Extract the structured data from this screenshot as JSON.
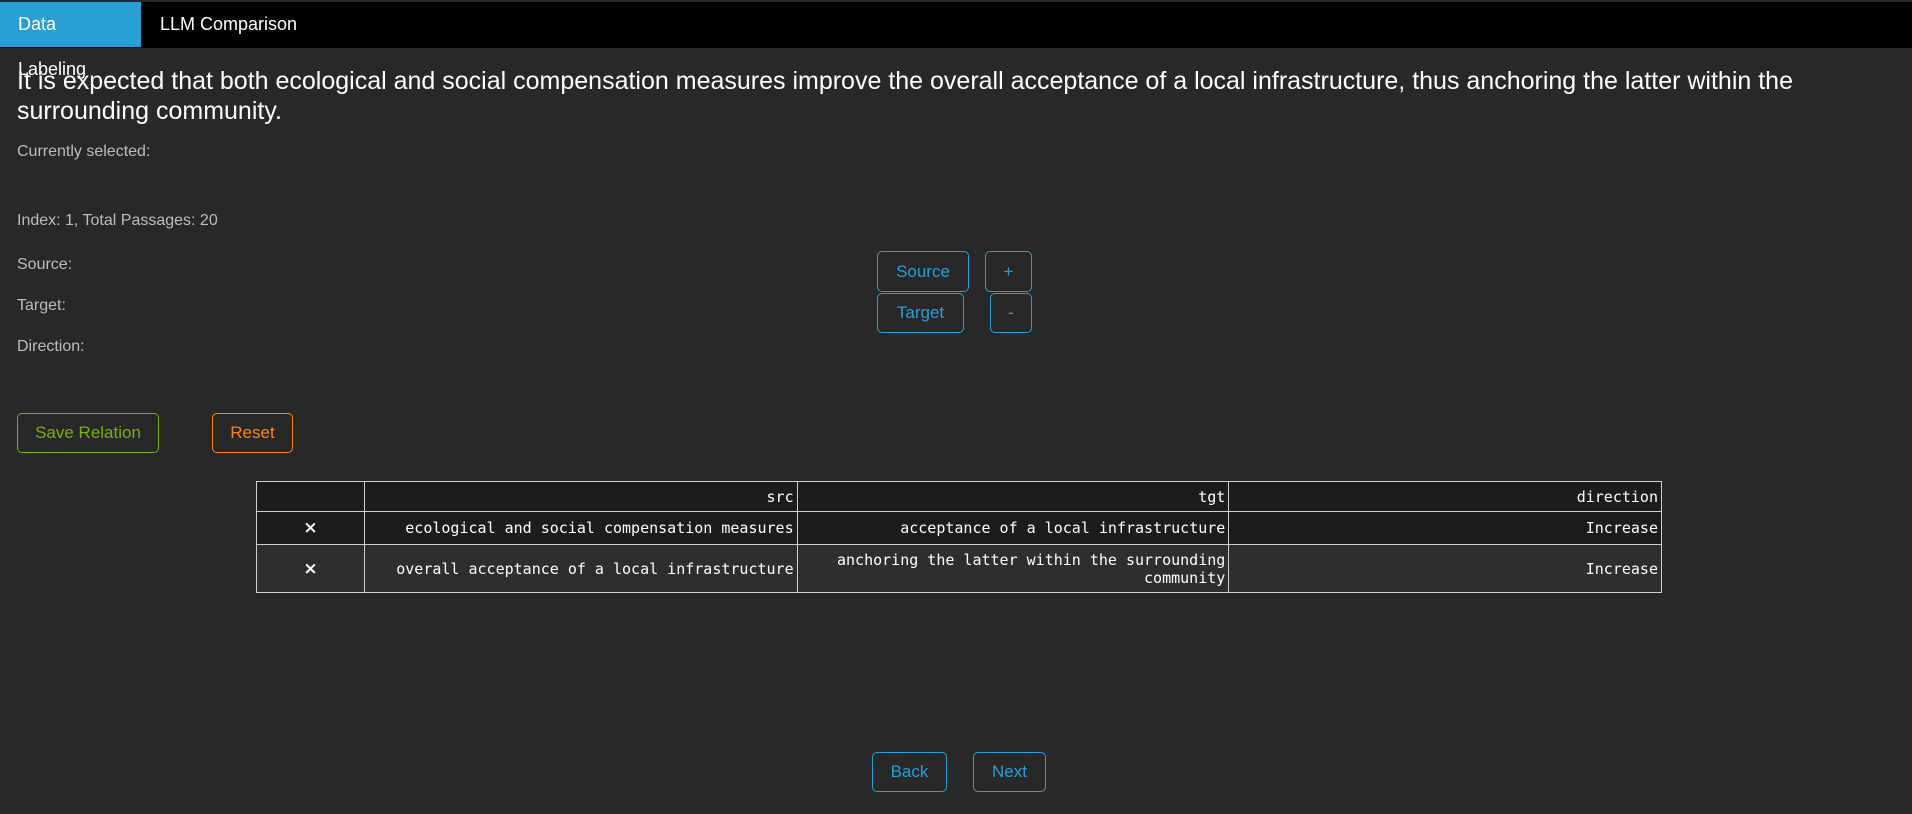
{
  "tabs": [
    {
      "label": "Data Labeling",
      "active": true
    },
    {
      "label": "LLM Comparison",
      "active": false
    }
  ],
  "passage": "It is expected that both ecological and social compensation measures improve the overall acceptance of a local infrastructure, thus anchoring the latter within the surrounding community.",
  "info": {
    "currently_selected": "Currently selected:",
    "index_text": "Index: 1, Total Passages: 20",
    "source": "Source:",
    "target": "Target:",
    "direction": "Direction:"
  },
  "controls": {
    "source_button": "Source",
    "target_button": "Target",
    "plus_button": "+",
    "minus_button": "-"
  },
  "actions": {
    "save": "Save Relation",
    "reset": "Reset"
  },
  "table": {
    "headers": [
      "",
      "src",
      "tgt",
      "direction"
    ],
    "delete_symbol": "×",
    "rows": [
      {
        "src": "ecological and social compensation measures",
        "tgt": "acceptance of a local infrastructure",
        "direction": "Increase"
      },
      {
        "src": "overall acceptance of a local infrastructure",
        "tgt": "anchoring the latter within the surrounding community",
        "direction": "Increase"
      }
    ]
  },
  "nav": {
    "back": "Back",
    "next": "Next"
  },
  "colors": {
    "primary": "#2a9fd6",
    "success": "#77b300",
    "warning": "#ff8800",
    "background": "#282828"
  }
}
